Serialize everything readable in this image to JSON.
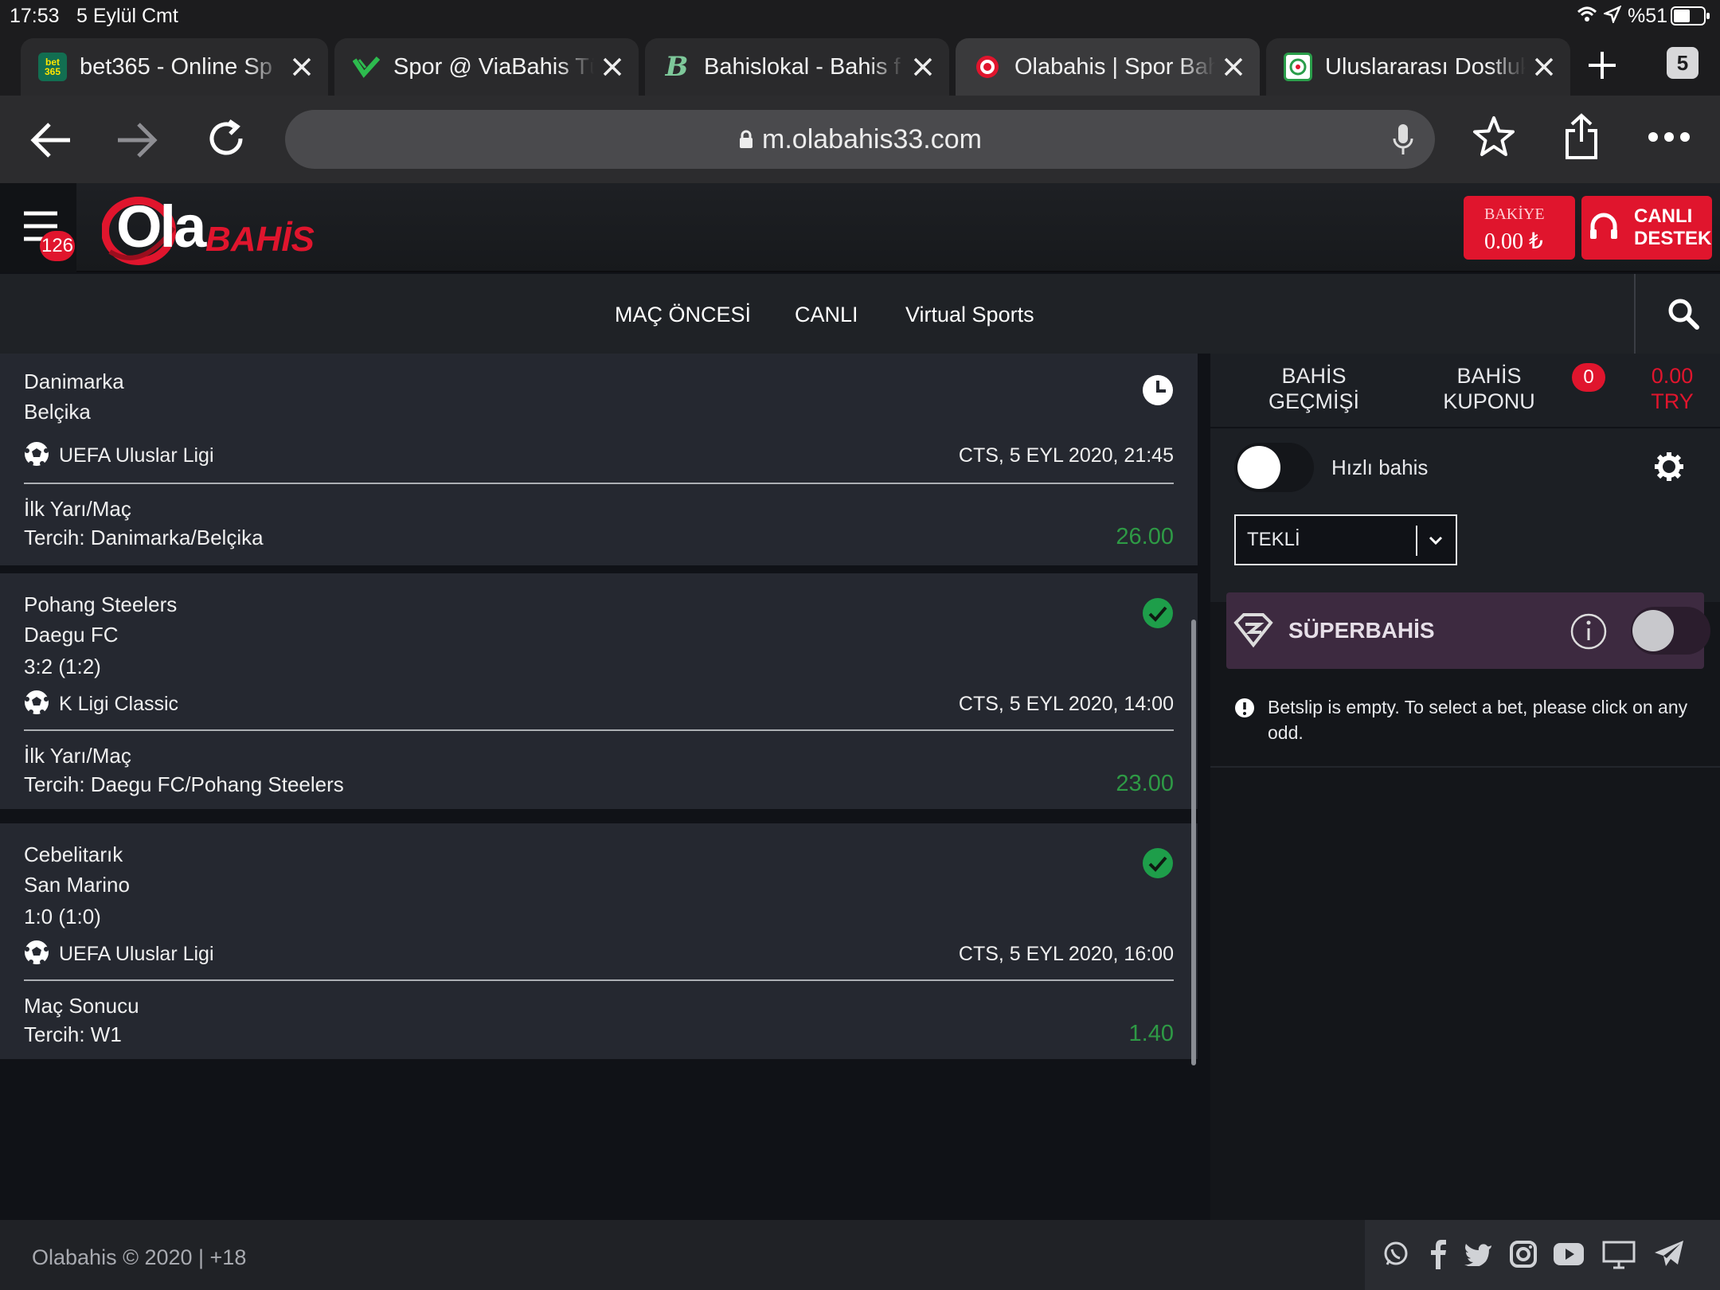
{
  "status": {
    "time": "17:53",
    "date": "5 Eylül Cmt",
    "battery": "%51"
  },
  "tabs": [
    {
      "title": "bet365 - Online Sp",
      "favicon": "bet\n365"
    },
    {
      "title": "Spor @ ViaBahis Tü",
      "favicon": "V"
    },
    {
      "title": "Bahislokal - Bahis f",
      "favicon": "B"
    },
    {
      "title": "Olabahis | Spor Bah",
      "favicon": "O"
    },
    {
      "title": "Uluslararası Dostluk",
      "favicon": "U"
    }
  ],
  "tab_count": "5",
  "url": "m.olabahis33.com",
  "header": {
    "notification_count": "126",
    "logo_main": "Ola",
    "logo_sub": "BAHİS",
    "balance_label": "BAKİYE",
    "balance_value": "0.00 ₺",
    "support_line1": "CANLI",
    "support_line2": "DESTEK"
  },
  "nav": {
    "pre_match": "MAÇ ÖNCESİ",
    "live": "CANLI",
    "virtual": "Virtual Sports"
  },
  "bets": [
    {
      "team1": "Danimarka",
      "team2": "Belçika",
      "score": "",
      "league": "UEFA Uluslar Ligi",
      "datetime": "CTS, 5 EYL 2020, 21:45",
      "market": "İlk Yarı/Maç",
      "choice": "Tercih: Danimarka/Belçika",
      "odd": "26.00",
      "status": "pending"
    },
    {
      "team1": "Pohang Steelers",
      "team2": "Daegu FC",
      "score": "3:2 (1:2)",
      "league": "K Ligi Classic",
      "datetime": "CTS, 5 EYL 2020, 14:00",
      "market": "İlk Yarı/Maç",
      "choice": "Tercih: Daegu FC/Pohang Steelers",
      "odd": "23.00",
      "status": "won"
    },
    {
      "team1": "Cebelitarık",
      "team2": "San Marino",
      "score": "1:0 (1:0)",
      "league": "UEFA Uluslar Ligi",
      "datetime": "CTS, 5 EYL 2020, 16:00",
      "market": "Maç Sonucu",
      "choice": "Tercih: W1",
      "odd": "1.40",
      "status": "won"
    }
  ],
  "betslip": {
    "history_line1": "BAHİS",
    "history_line2": "GEÇMİŞİ",
    "coupon_line1": "BAHİS",
    "coupon_line2": "KUPONU",
    "coupon_count": "0",
    "total_value": "0.00",
    "total_currency": "TRY",
    "quick_bet_label": "Hızlı bahis",
    "bet_type": "TEKLİ",
    "superbet_label": "SÜPERBAHİS",
    "empty_message": "Betslip is empty. To select a bet, please click on any odd."
  },
  "footer": {
    "copyright": "Olabahis © 2020 | +18"
  },
  "colors": {
    "brand_red": "#e0152d",
    "odd_green": "#2e9a45",
    "won_green": "#1e9e4a",
    "superbet_bg": "#3d2a40"
  }
}
